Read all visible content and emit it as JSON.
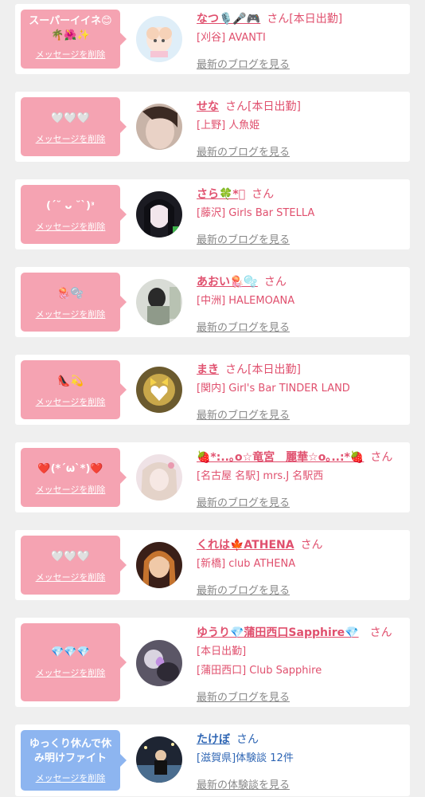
{
  "delete_label": "メッセージを削除",
  "cards": [
    {
      "message": "スーパーイイネ😊🌴🌺✨",
      "name": "なつ🎙️🎤🎮",
      "suffix": "さん[本日出勤]",
      "shop": "[刈谷] AVANTI",
      "link": "最新のブログを見る"
    },
    {
      "message": "🤍🤍🤍",
      "name": "せな",
      "suffix": "さん[本日出勤]",
      "shop": "[上野] 人魚姫",
      "link": "最新のブログを見る"
    },
    {
      "message": "(ˊ˘ ᴗ ˘ˋ)ᵌ",
      "name": "さら🍀*ﾟ",
      "suffix": "さん",
      "shop": "[藤沢] Girls Bar STELLA",
      "link": "最新のブログを見る"
    },
    {
      "message": "🪼🫧",
      "name": "あおい🪼🫧",
      "suffix": "さん",
      "shop": "[中洲] HALEMOANA",
      "link": "最新のブログを見る"
    },
    {
      "message": "👠💫",
      "name": "まき",
      "suffix": "さん[本日出勤]",
      "shop": "[関内] Girl's Bar TINDER LAND",
      "link": "最新のブログを見る"
    },
    {
      "message": "❤️(*´ω`*)❤️",
      "name": "🍓*:..｡o☆竜宮　麗華☆o｡..:*🍓",
      "suffix": "さん",
      "shop": "[名古屋 名駅] mrs.J 名駅西",
      "link": "最新のブログを見る"
    },
    {
      "message": "🤍🤍🤍",
      "name": "くれは🍁ATHENA",
      "suffix": "さん",
      "shop": "[新橋] club ATHENA",
      "link": "最新のブログを見る"
    },
    {
      "message": "💎💎💎",
      "name": "ゆうり💎蒲田西口Sapphire💎",
      "suffix": "さん",
      "status": "[本日出勤]",
      "shop": "[蒲田西口] Club Sapphire",
      "link": "最新のブログを見る"
    },
    {
      "message": "ゆっくり休んで休み明けファイト",
      "name": "たけぼ",
      "suffix": "さん",
      "shop": "[滋賀県]体験談 12件",
      "link": "最新の体験談を見る"
    }
  ]
}
